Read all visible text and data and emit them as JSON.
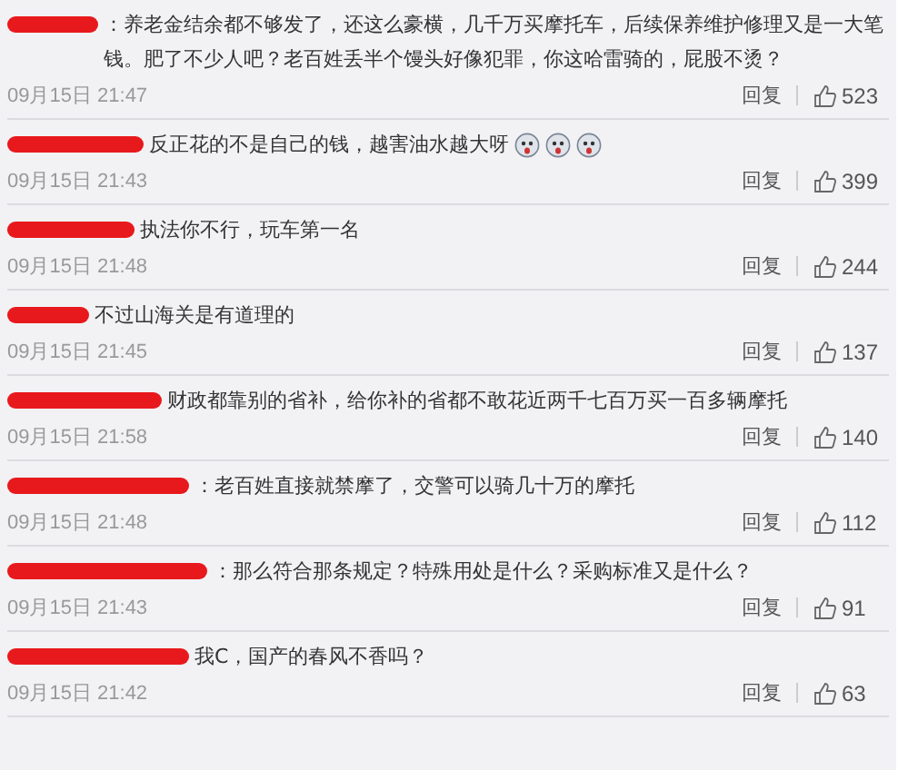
{
  "comments": [
    {
      "text": "：养老金结余都不够发了，还这么豪横，几千万买摩托车，后续保养维护修理又是一大笔钱。肥了不少人吧？老百姓丢半个馒头好像犯罪，你这哈雷骑的，屁股不烫？",
      "time": "09月15日 21:47",
      "reply": "回复",
      "likes": "523"
    },
    {
      "text": "反正花的不是自己的钱，越害油水越大呀",
      "emojis": [
        {
          "kind": "face"
        },
        {
          "kind": "face"
        },
        {
          "kind": "face"
        }
      ],
      "time": "09月15日 21:43",
      "reply": "回复",
      "likes": "399"
    },
    {
      "text": "执法你不行，玩车第一名",
      "time": "09月15日 21:48",
      "reply": "回复",
      "likes": "244"
    },
    {
      "text": "不过山海关是有道理的",
      "time": "09月15日 21:45",
      "reply": "回复",
      "likes": "137"
    },
    {
      "text": "财政都靠别的省补，给你补的省都不敢花近两千七百万买一百多辆摩托",
      "time": "09月15日 21:58",
      "reply": "回复",
      "likes": "140"
    },
    {
      "text": "：老百姓直接就禁摩了，交警可以骑几十万的摩托",
      "time": "09月15日 21:48",
      "reply": "回复",
      "likes": "112"
    },
    {
      "text": "：那么符合那条规定？特殊用处是什么？采购标准又是什么？",
      "time": "09月15日 21:43",
      "reply": "回复",
      "likes": "91"
    },
    {
      "text": "我C，国产的春风不香吗？",
      "time": "09月15日 21:42",
      "reply": "回复",
      "likes": "63"
    }
  ]
}
